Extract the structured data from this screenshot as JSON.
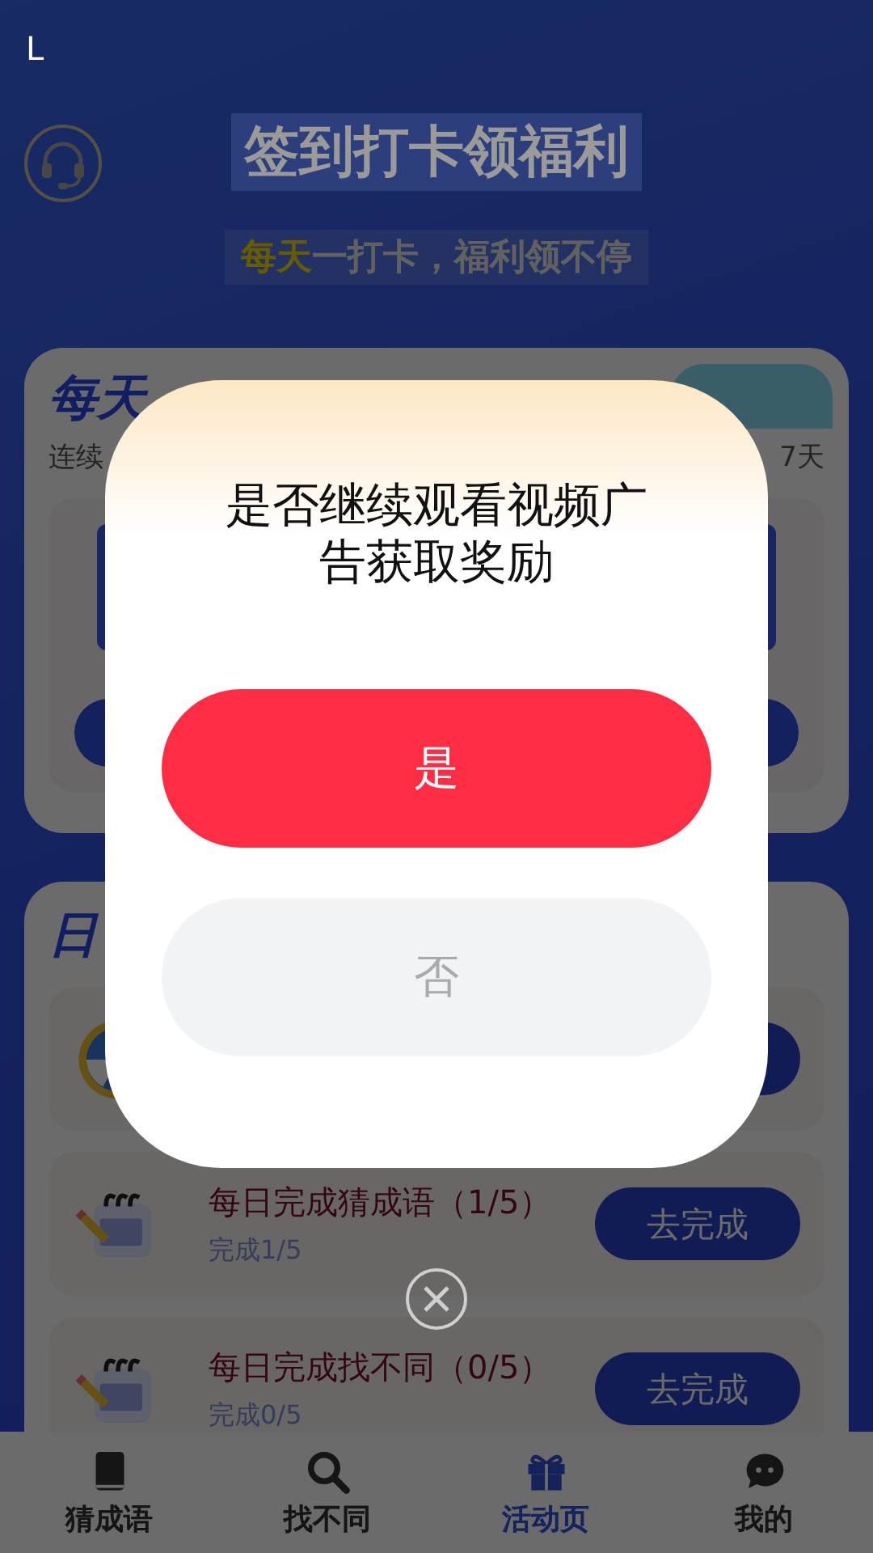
{
  "status_bar": {
    "text": "L"
  },
  "header": {
    "title": "签到打卡领福利",
    "subtitle_highlight": "每天",
    "subtitle_rest": "一打卡，福利领不停"
  },
  "checkin_card": {
    "title": "每天",
    "subtitle_left": "连续",
    "subtitle_right": "7天"
  },
  "tasks_card": {
    "title": "日",
    "rows": [
      {
        "kind": "wheel"
      },
      {
        "kind": "notebook",
        "title": "每日完成猜成语（1/5）",
        "progress": "完成1/5",
        "button": "去完成"
      },
      {
        "kind": "notebook",
        "title": "每日完成找不同（0/5）",
        "progress": "完成0/5",
        "button": "去完成"
      }
    ]
  },
  "dialog": {
    "message": "是否继续观看视频广告获取奖励",
    "confirm": "是",
    "cancel": "否"
  },
  "tabs": [
    {
      "label": "猜成语",
      "selected": false
    },
    {
      "label": "找不同",
      "selected": false
    },
    {
      "label": "活动页",
      "selected": true
    },
    {
      "label": "我的",
      "selected": false
    }
  ]
}
